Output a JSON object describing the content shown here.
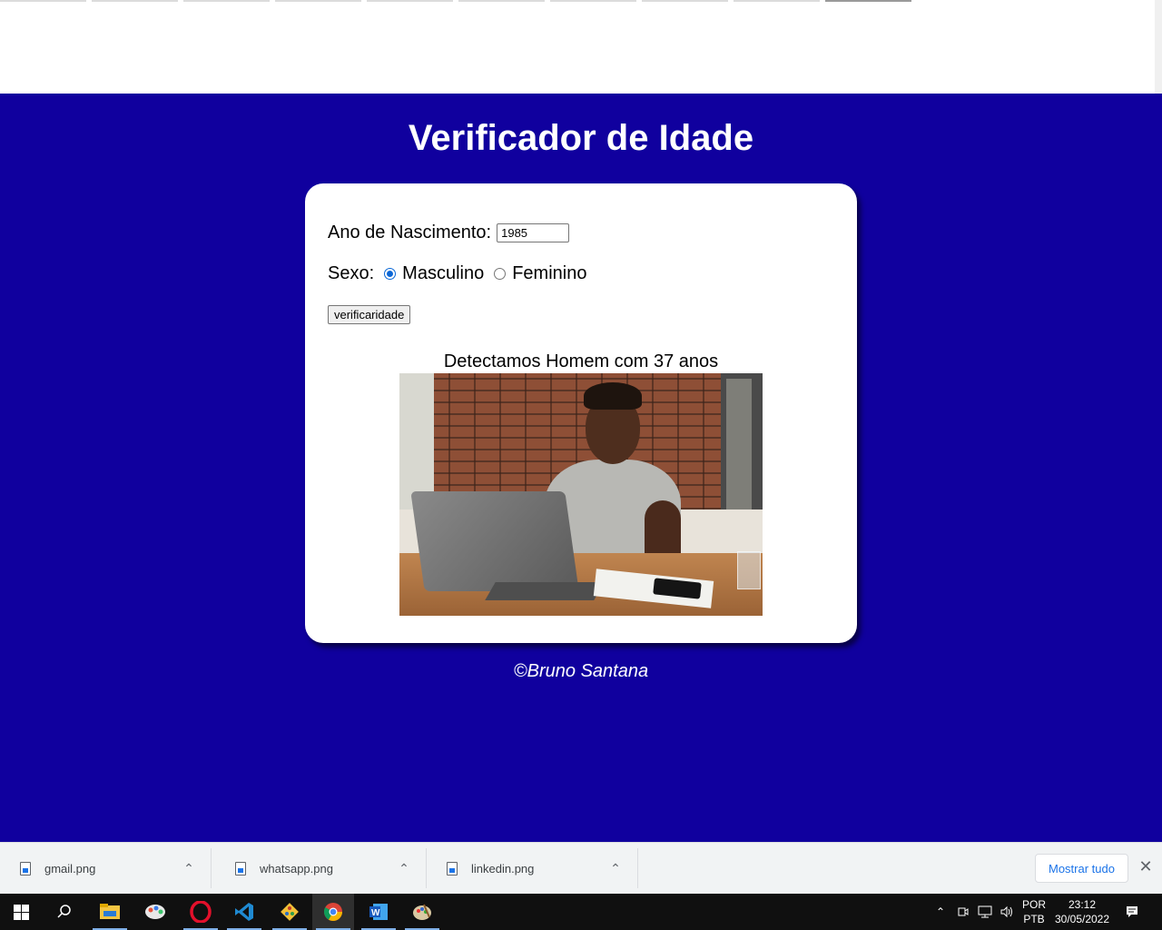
{
  "page": {
    "title": "Verificador de Idade",
    "year_label": "Ano de Nascimento:",
    "year_value": "1985",
    "sex_label": "Sexo:",
    "sex_options": [
      {
        "label": "Masculino",
        "checked": true
      },
      {
        "label": "Feminino",
        "checked": false
      }
    ],
    "check_button": "verificaridade",
    "result_text": "Detectamos Homem com 37 anos",
    "credit": "©Bruno Santana",
    "background_color": "#10009e"
  },
  "downloads": {
    "items": [
      "gmail.png",
      "whatsapp.png",
      "linkedin.png"
    ],
    "show_all": "Mostrar tudo"
  },
  "taskbar": {
    "apps": [
      "windows-start-icon",
      "search-icon",
      "file-explorer-icon",
      "paint-3d-icon",
      "opera-icon",
      "vscode-icon",
      "git-icon",
      "chrome-icon",
      "word-icon",
      "paint-icon"
    ],
    "lang_line1": "POR",
    "lang_line2": "PTB",
    "time": "23:12",
    "date": "30/05/2022"
  }
}
